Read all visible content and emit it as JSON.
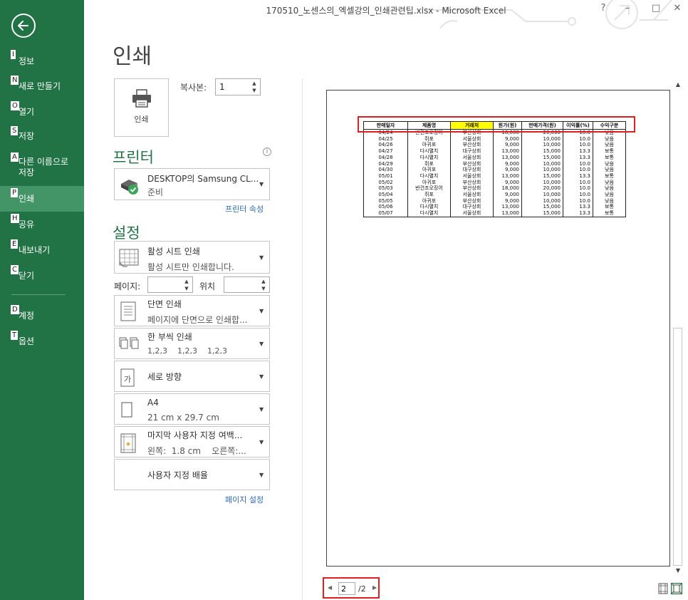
{
  "window": {
    "title": "170510_노센스의_엑셀강의_인쇄관련팁.xlsx - Microsoft Excel",
    "controls": [
      "?",
      "–",
      "□",
      "✕"
    ]
  },
  "sidebar": {
    "items": [
      {
        "key": "I",
        "label": "정보"
      },
      {
        "key": "N",
        "label": "새로 만들기"
      },
      {
        "key": "O",
        "label": "열기"
      },
      {
        "key": "S",
        "label": "저장"
      },
      {
        "key": "A",
        "label": "다른 이름으로 저장"
      },
      {
        "key": "P",
        "label": "인쇄"
      },
      {
        "key": "H",
        "label": "공유"
      },
      {
        "key": "E",
        "label": "내보내기"
      },
      {
        "key": "C",
        "label": "닫기"
      },
      {
        "key": "D",
        "label": "계정"
      },
      {
        "key": "T",
        "label": "옵션"
      }
    ],
    "active": "인쇄"
  },
  "print": {
    "heading": "인쇄",
    "button_label": "인쇄",
    "copies_label": "복사본:",
    "copies_value": "1"
  },
  "printer": {
    "heading": "프린터",
    "name": "DESKTOP의 Samsung CL...",
    "status": "준비",
    "properties_link": "프린터 속성"
  },
  "settings": {
    "heading": "설정",
    "what": {
      "title": "활성 시트 인쇄",
      "subtitle": "활성 시트만 인쇄합니다."
    },
    "pages_label": "페이지:",
    "to_label": "위치",
    "sides": {
      "title": "단면 인쇄",
      "subtitle": "페이지에 단면으로 인쇄합..."
    },
    "collate": {
      "title": "한 부씩 인쇄",
      "subtitle": "1,2,3    1,2,3    1,2,3"
    },
    "orientation": {
      "title": "세로 방향"
    },
    "paper": {
      "title": "A4",
      "subtitle": "21 cm x 29.7 cm"
    },
    "margins": {
      "title": "마지막 사용자 지정 여백...",
      "subtitle": "왼쪽:  1.8 cm    오른쪽:..."
    },
    "scaling": {
      "title": "사용자 지정 배율"
    },
    "page_setup_link": "페이지 설정"
  },
  "preview": {
    "headers": [
      "판매일자",
      "제품명",
      "거래처",
      "원가(원)",
      "판매가격(원)",
      "이익률(%)",
      "수익구분"
    ],
    "highlight_header": "거래처",
    "rows": [
      [
        "04/24",
        "반건조오징어",
        "부산상회",
        "18,000",
        "20,000",
        "10.0",
        "낮음"
      ],
      [
        "04/25",
        "쥐포",
        "서울상회",
        "9,000",
        "10,000",
        "10.0",
        "낮음"
      ],
      [
        "04/26",
        "아귀포",
        "부산상회",
        "9,000",
        "10,000",
        "10.0",
        "낮음"
      ],
      [
        "04/27",
        "다시멸치",
        "대구상회",
        "13,000",
        "15,000",
        "13.3",
        "보통"
      ],
      [
        "04/28",
        "다시멸치",
        "서울상회",
        "13,000",
        "15,000",
        "13.3",
        "보통"
      ],
      [
        "04/29",
        "쥐포",
        "부산상회",
        "9,000",
        "10,000",
        "10.0",
        "낮음"
      ],
      [
        "04/30",
        "아귀포",
        "대구상회",
        "9,000",
        "10,000",
        "10.0",
        "낮음"
      ],
      [
        "05/01",
        "다시멸치",
        "서울상회",
        "13,000",
        "15,000",
        "13.3",
        "보통"
      ],
      [
        "05/02",
        "아귀포",
        "부산상회",
        "9,000",
        "10,000",
        "10.0",
        "낮음"
      ],
      [
        "05/03",
        "반건조오징어",
        "부산상회",
        "18,000",
        "20,000",
        "10.0",
        "낮음"
      ],
      [
        "05/04",
        "쥐포",
        "서울상회",
        "9,000",
        "10,000",
        "10.0",
        "낮음"
      ],
      [
        "05/05",
        "아귀포",
        "부산상회",
        "9,000",
        "10,000",
        "10.0",
        "낮음"
      ],
      [
        "05/06",
        "다시멸치",
        "대구상회",
        "13,000",
        "15,000",
        "13.3",
        "보통"
      ],
      [
        "05/07",
        "다시멸치",
        "서울상회",
        "13,000",
        "15,000",
        "13.3",
        "보통"
      ]
    ]
  },
  "pager": {
    "current": "2",
    "total": "/2"
  },
  "colors": {
    "sidebar_bg": "#217346",
    "sidebar_active": "#439467",
    "accent_green": "#217346",
    "link_blue": "#2a6bb8",
    "highlight_red": "#e02020",
    "header_yellow": "#ffff00"
  },
  "icons": [
    "back-arrow-icon",
    "printer-icon",
    "printer-ready-icon",
    "sheet-grid-icon",
    "single-sided-icon",
    "collate-icon",
    "portrait-icon",
    "paper-icon",
    "margins-icon",
    "info-icon",
    "show-margins-icon",
    "zoom-page-icon"
  ]
}
